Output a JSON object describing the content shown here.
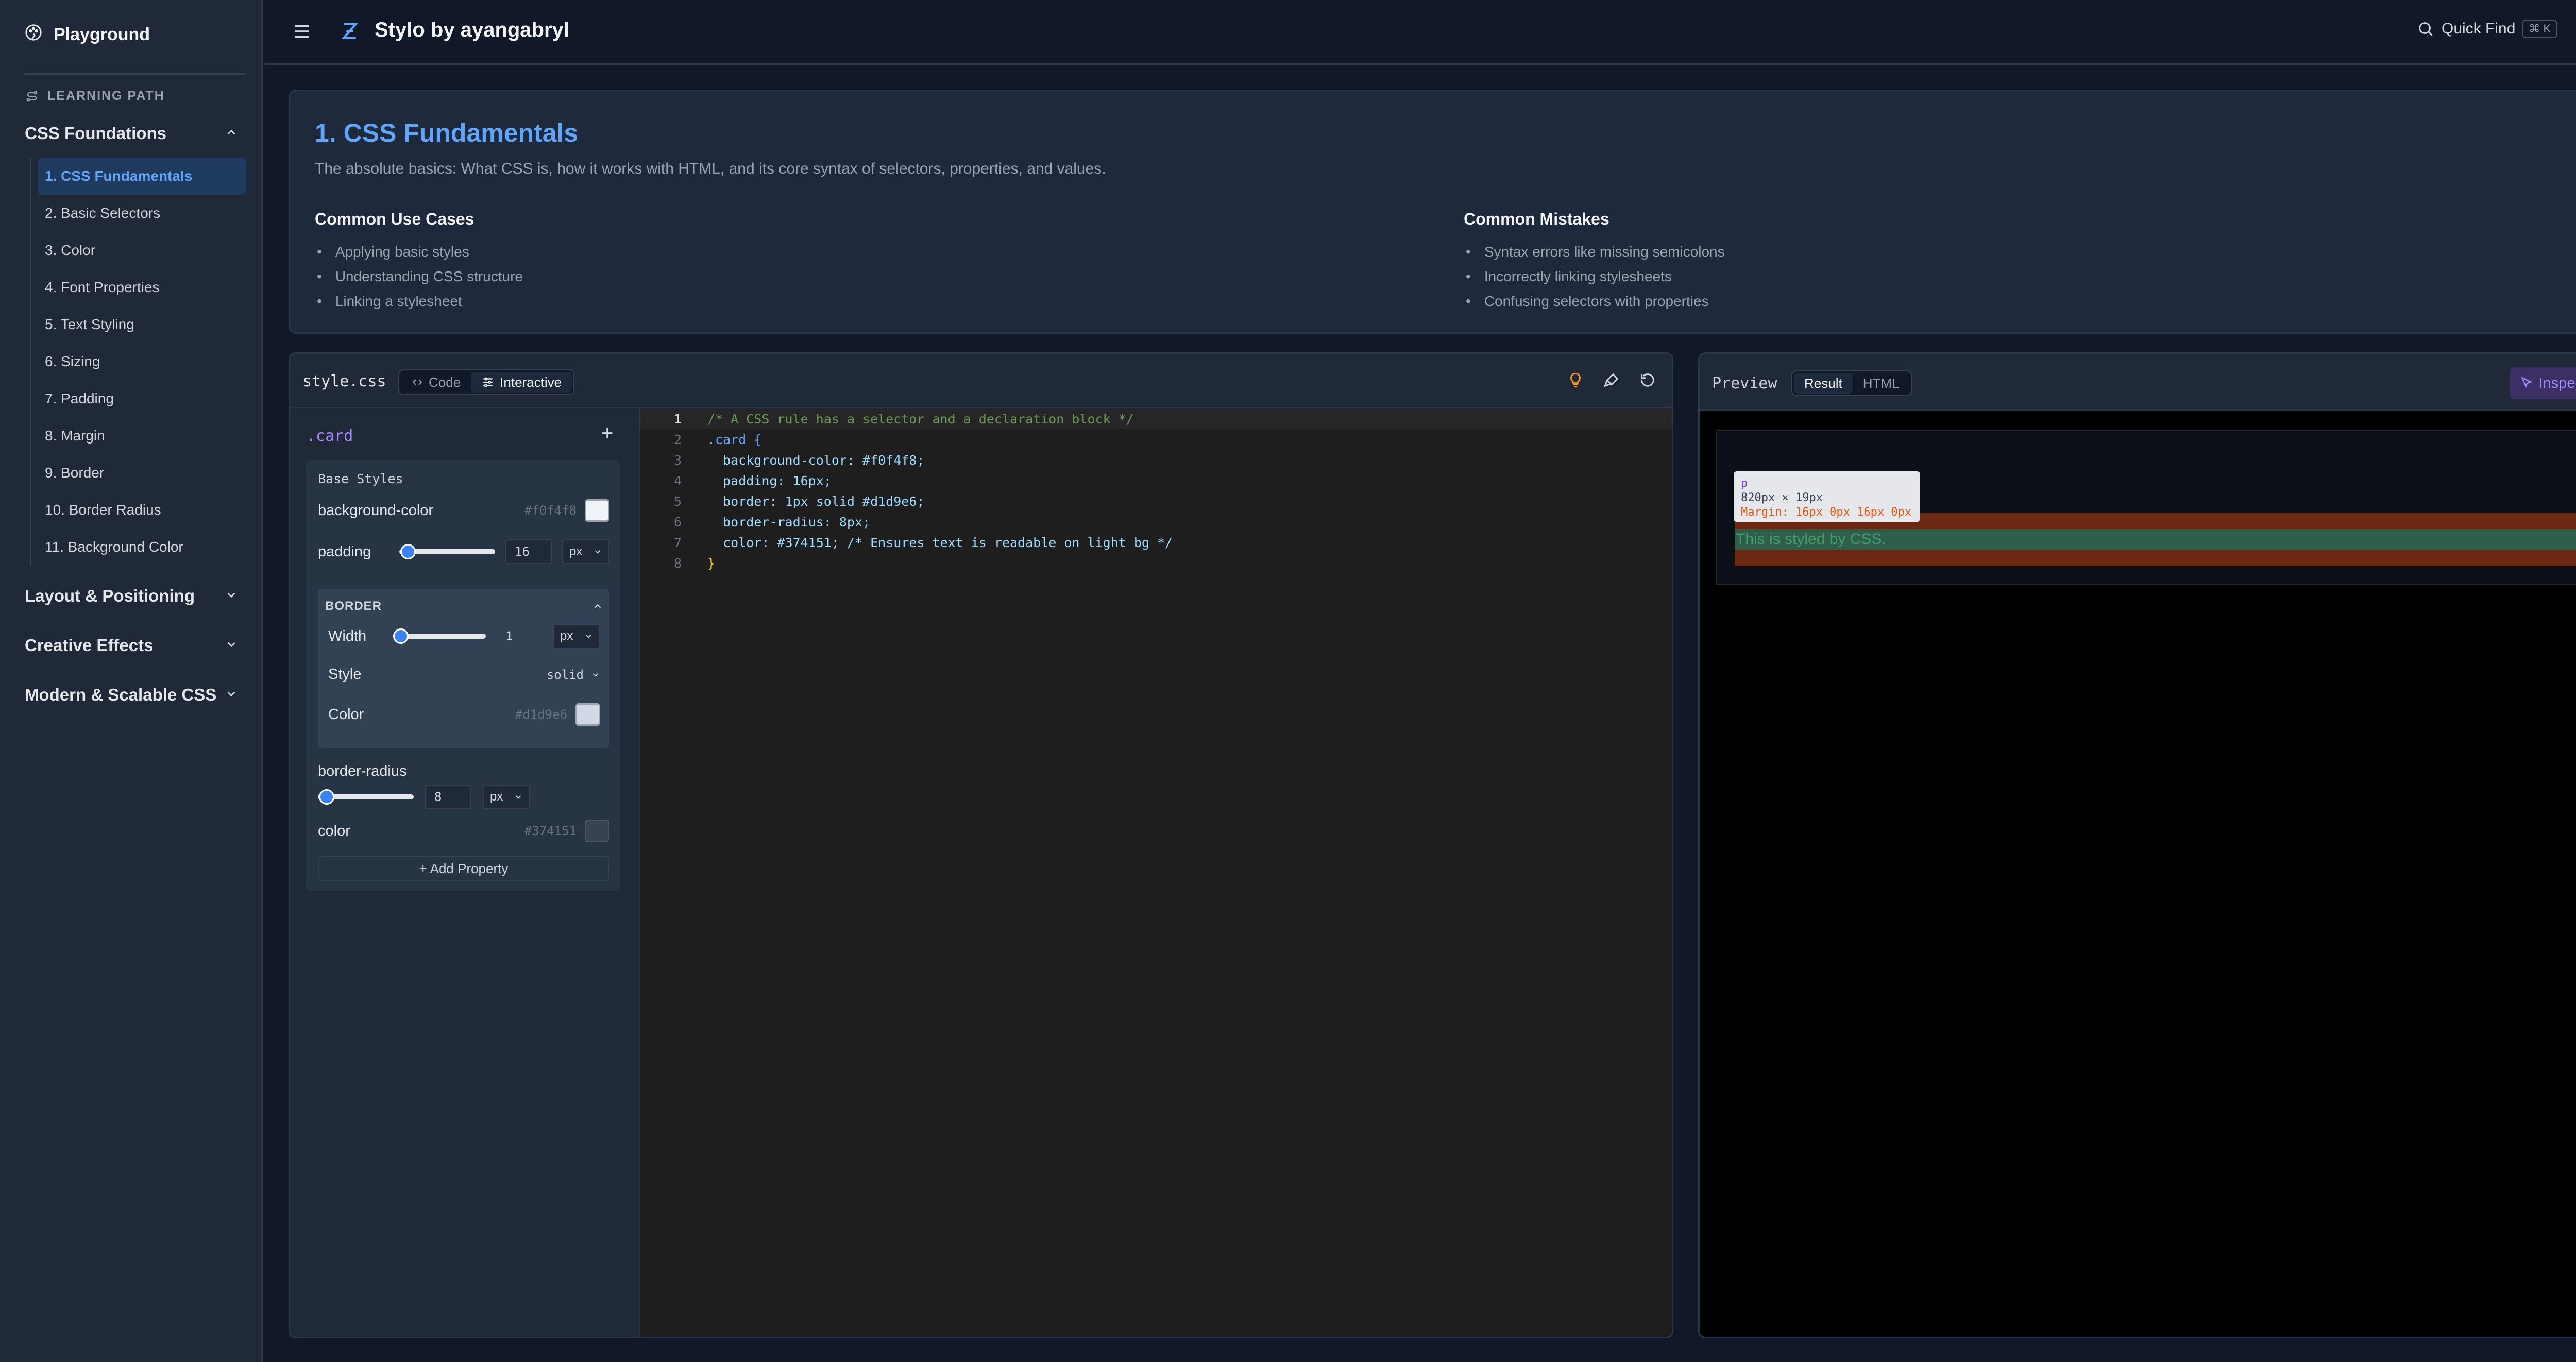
{
  "sidebar": {
    "brand": "Playground",
    "section_label": "LEARNING PATH",
    "groups": [
      {
        "label": "CSS Foundations",
        "expanded": true
      },
      {
        "label": "Layout & Positioning",
        "expanded": false
      },
      {
        "label": "Creative Effects",
        "expanded": false
      },
      {
        "label": "Modern & Scalable CSS",
        "expanded": false
      }
    ],
    "items": [
      "1. CSS Fundamentals",
      "2. Basic Selectors",
      "3. Color",
      "4. Font Properties",
      "5. Text Styling",
      "6. Sizing",
      "7. Padding",
      "8. Margin",
      "9. Border",
      "10. Border Radius",
      "11. Background Color"
    ],
    "active_item": "1. CSS Fundamentals"
  },
  "header": {
    "title": "Stylo by ayangabryl",
    "quick_find": "Quick Find",
    "shortcut": "⌘ K"
  },
  "lesson": {
    "title": "1. CSS Fundamentals",
    "description": "The absolute basics: What CSS is, how it works with HTML, and its core syntax of selectors, properties, and values.",
    "use_cases_heading": "Common Use Cases",
    "use_cases": [
      "Applying basic styles",
      "Understanding CSS structure",
      "Linking a stylesheet"
    ],
    "mistakes_heading": "Common Mistakes",
    "mistakes": [
      "Syntax errors like missing semicolons",
      "Incorrectly linking stylesheets",
      "Confusing selectors with properties"
    ]
  },
  "editor": {
    "filename": "style.css",
    "mode_tabs": [
      "Code",
      "Interactive"
    ],
    "active_mode": "Interactive",
    "selector": ".card",
    "base_styles_label": "Base Styles",
    "props": {
      "background_color": {
        "label": "background-color",
        "value": "#f0f4f8"
      },
      "padding": {
        "label": "padding",
        "value": "16",
        "unit": "px",
        "level": 0.03
      },
      "border": {
        "heading": "BORDER",
        "width_label": "Width",
        "width_value": "1",
        "width_unit": "px",
        "width_level": 0.02,
        "style_label": "Style",
        "style_value": "solid",
        "color_label": "Color",
        "color_value": "#d1d9e6"
      },
      "border_radius": {
        "label": "border-radius",
        "value": "8",
        "unit": "px",
        "level": 0.03
      },
      "color": {
        "label": "color",
        "value": "#374151"
      }
    },
    "add_property": "+ Add Property",
    "code_lines": [
      "/* A CSS rule has a selector and a declaration block */",
      ".card {",
      "  background-color: #f0f4f8;",
      "  padding: 16px;",
      "  border: 1px solid #d1d9e6;",
      "  border-radius: 8px;",
      "  color: #374151; /* Ensures text is readable on light bg */",
      "}"
    ],
    "line_numbers": [
      "1",
      "2",
      "3",
      "4",
      "5",
      "6",
      "7",
      "8"
    ]
  },
  "preview": {
    "title": "Preview",
    "tabs": [
      "Result",
      "HTML"
    ],
    "active_tab": "Result",
    "inspect_label": "Inspect",
    "tooltip_tag": "p",
    "tooltip_dims": "820px × 19px",
    "tooltip_margin": "Margin: 16px 0px 16px 0px",
    "sample_text": "This is styled by CSS."
  },
  "colors": {
    "accent": "#60a5fa",
    "active_bg": "#1e3a5f",
    "inspect": "#a78bfa",
    "margin_overlay": "#7c2d12",
    "content_overlay": "#2f5f4a"
  }
}
